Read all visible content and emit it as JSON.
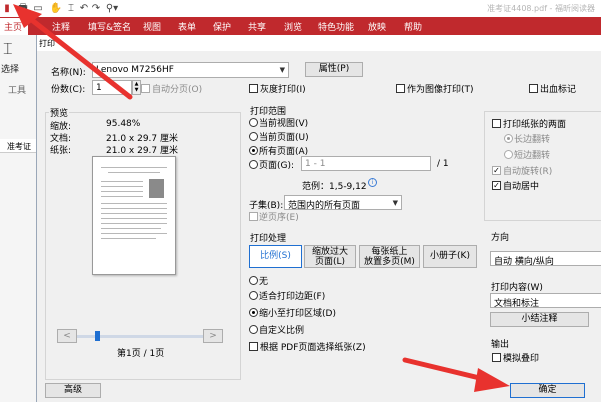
{
  "app_title": "准考证4408.pdf - 福昕阅读器",
  "menu": [
    "主页",
    "注释",
    "填写&签名",
    "视图",
    "表单",
    "保护",
    "共享",
    "浏览",
    "特色功能",
    "放映",
    "帮助"
  ],
  "ribbon": {
    "select_label": "选择",
    "tools_label": "工具",
    "doc_tab": "准考证"
  },
  "dialog": {
    "title": "打印",
    "printer": {
      "name_label": "名称(N):",
      "name_value": "Lenovo M7256HF",
      "properties_btn": "属性(P)"
    },
    "copies": {
      "label": "份数(C):",
      "value": "1",
      "collate": "自动分页(O)"
    },
    "grayscale": "灰度打印(I)",
    "as_image": "作为图像打印(T)",
    "annotations": "出血标记",
    "preview": {
      "title": "预览",
      "zoom_label": "缩放:",
      "zoom_value": "95.48%",
      "doc_label": "文档:",
      "doc_value": "21.0 x 29.7 厘米",
      "paper_label": "纸张:",
      "paper_value": "21.0 x 29.7 厘米",
      "page_indicator": "第1页 / 1页",
      "prev": "<",
      "next": ">"
    },
    "range": {
      "title": "打印范围",
      "current_view": "当前视图(V)",
      "current_page": "当前页面(U)",
      "all_pages": "所有页面(A)",
      "pages": "页面(G):",
      "pages_placeholder": "1 - 1",
      "pages_total": "/ 1",
      "range_example": "范例：1,5-9,12",
      "subset_label": "子集(B):",
      "subset_value": "范围内的所有页面",
      "reverse": "逆页序(E)"
    },
    "handling": {
      "title": "打印处理",
      "tabs": [
        "比例(S)",
        "缩放过大\n页面(L)",
        "每张纸上\n放置多页(M)",
        "小册子(K)"
      ],
      "none": "无",
      "fit_margins": "适合打印边距(F)",
      "shrink": "缩小至打印区域(D)",
      "custom": "自定义比例",
      "by_pdf_size": "根据 PDF页面选择纸张(Z)"
    },
    "right": {
      "duplex": "打印纸张的两面",
      "long_edge": "长边翻转",
      "short_edge": "短边翻转",
      "auto_rotate": "自动旋转(R)",
      "auto_center": "自动居中",
      "orientation_title": "方向",
      "orientation_value": "自动 横向/纵向",
      "content_title": "打印内容(W)",
      "content_value": "文档和标注",
      "summary_btn": "小结注释",
      "output_title": "输出",
      "simulate": "模拟叠印"
    },
    "advanced_btn": "高级",
    "ok_btn": "确定"
  },
  "colors": {
    "brand": "#c0292d",
    "arrow": "#e8322e"
  }
}
